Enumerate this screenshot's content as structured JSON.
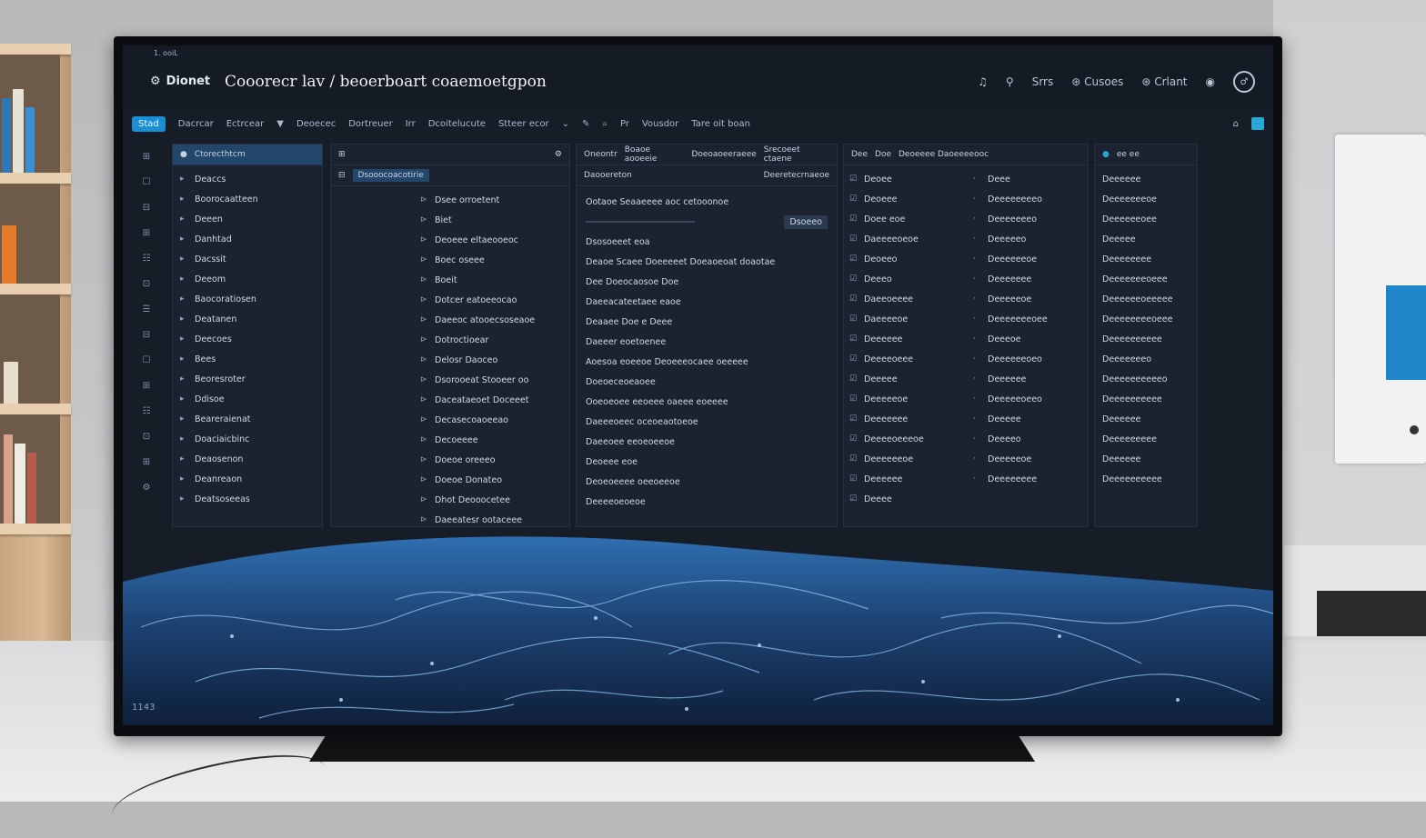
{
  "window": {
    "tiny_label": "1. ooiL",
    "app_name": "Dionet",
    "title": "Cooorecr lav / beoerboart coaemoetgpon",
    "top_right": {
      "items": [
        "Srrs",
        "Cusoes",
        "Crlant"
      ],
      "profile_icon": "user-circle-icon"
    }
  },
  "toolbar": {
    "badge": "Stad",
    "items": [
      "Dacrcar",
      "Ectrcear",
      "Deoecec",
      "Dortreuer",
      "Irr",
      "Dcoitelucute",
      "Stteer ecor"
    ],
    "right_items": [
      "Pr",
      "Vousdor",
      "Tare oit boan"
    ]
  },
  "nav_panel": {
    "header": "Ctorecthtcm",
    "items": [
      "Deaccs",
      "Boorocaatteen",
      "Deeen",
      "Danhtad",
      "Dacssit",
      "Deeom",
      "Baocoratiosen",
      "Deatanen",
      "Deecoes",
      "Bees",
      "Beoresroter",
      "Ddisoe",
      "Beareraienat",
      "Doaciaicbinc",
      "Deaosenon",
      "Deanreaon",
      "Deatsoseeas"
    ]
  },
  "file_panel": {
    "header": "Dsooocoacotirie",
    "rows": [
      "Dsee orroetent",
      "Biet",
      "Deoeee eltaeooeoc",
      "Boec oseee",
      "Boeit",
      "Dotcer eatoeeocao",
      "Daeeoc atooecsoseaoe",
      "Dotroctioear",
      "Delosr Daoceo",
      "Dsorooeat Stooeer oo",
      "Daceataeoet Doceeet",
      "Decasecoaoeeao",
      "Decoeeee",
      "Doeoe oreeeo",
      "Doeoe Donateo",
      "Dhot Deooocetee",
      "Daeeatesr ootaceee"
    ]
  },
  "editor_panel": {
    "tabs": [
      "Oneontr",
      "Boaoe aooeeie",
      "Doeoaoeeraeee",
      "Srecoeet ctaene"
    ],
    "title": "Daooereton",
    "subtitle": "Deeretecrnaeoe",
    "section": "Ootaoe Seaaeeee aoc cetooonoe",
    "button": "Dsoeeo",
    "lines": [
      "Dsosoeeet eoa",
      "Deaoe Scaee Doeeeeet Doeaoeoat doaotae",
      "Dee Doeocaosoe Doe",
      "Daeeacateetaee eaoe",
      "Deaaee Doe e Deee",
      "Daeeer eoetoenee",
      "Aoesoa eoeeoe Deoeeeocaee oeeeee",
      "Doeoeceoeaoee",
      "Ooeoeoee eeoeee oaeee eoeeee",
      "Daeeeoeec oceoeaotoeoe",
      "Daeeoee eeoeoeeoe",
      "Deoeee eoe",
      "Deoeoeeee oeeoeeoe",
      "Deeeeoeoeoe"
    ]
  },
  "list_panel": {
    "tabs": [
      "Dee",
      "Doe",
      "Deoeeee Daoeeeeooc"
    ],
    "col1": [
      "Deoee",
      "Deoeee",
      "Doee eoe",
      "Daeeeeoeoe",
      "Deoeeo",
      "Deeeo",
      "Daeeoeeee",
      "Daeeeeoe",
      "Deeeeee",
      "Deeeeoeee",
      "Deeeee",
      "Deeeeeoe",
      "Deeeeeee",
      "Deeeeoeeeoe",
      "Deeeeeeoe",
      "Deeeeee",
      "Deeee"
    ],
    "col2": [
      "Deee",
      "Deeeeeeeeo",
      "Deeeeeeeo",
      "Deeeeeo",
      "Deeeeeeoe",
      "Deeeeeee",
      "Deeeeeoe",
      "Deeeeeeeoee",
      "Deeeoe",
      "Deeeeeeoeo",
      "Deeeeee",
      "Deeeeeoeeo",
      "Deeeee",
      "Deeeeo",
      "Deeeeeoe",
      "Deeeeeeee"
    ]
  },
  "right_panel": {
    "status": "ee ee",
    "items": [
      "Deeeeee",
      "Deeeeeeeoe",
      "Deeeeeeoee",
      "Deeeee",
      "Deeeeeeee",
      "Deeeeeeeoeee",
      "Deeeeeeoeeeee",
      "Deeeeeeeeoeee",
      "Deeeeeeeeee",
      "Deeeeeeeo",
      "Deeeeeeeeeeo",
      "Deeeeeeeeee",
      "Deeeeee",
      "Deeeeeeeee",
      "Deeeeee",
      "Deeeeeeeeee"
    ]
  },
  "corner": {
    "text": "1143"
  },
  "colors": {
    "accent": "#1a8fd6",
    "background": "#161d27",
    "panel": "#1b2330",
    "wave": "#2f73b8"
  }
}
